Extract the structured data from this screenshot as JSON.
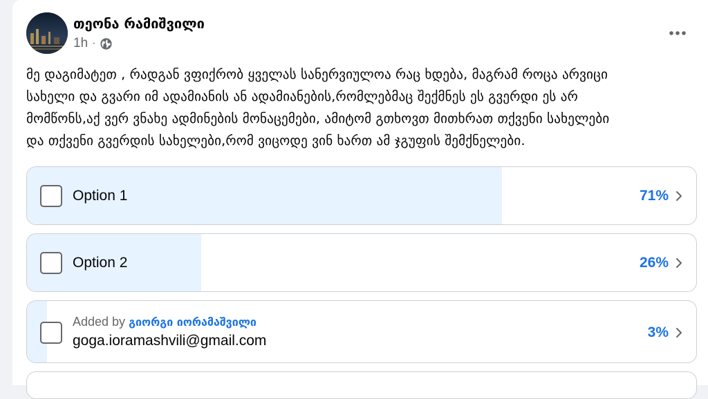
{
  "post": {
    "author": "თეონა რამიშვილი",
    "time": "1h",
    "privacy_icon": "globe-icon",
    "more_icon": "more-horizontal-icon",
    "text_lines": [
      "მე დაგიმატეთ , რადგან ვფიქრობ ყველას სანერვიულოა რაც ხდება, მაგრამ როცა არვიცი",
      "სახელი და გვარი იმ ადამიანის ან ადამიანების,რომლებმაც შექმნეს ეს გვერდი ეს არ",
      "მომწონს,აქ ვერ ვნახე ადმინების მონაცემები, ამიტომ გთხოვთ მითხრათ თქვენი სახელები",
      "და თქვენი გვერდის სახელები,რომ ვიცოდე ვინ ხართ ამ ჯგუფის შემქნელები."
    ]
  },
  "poll": {
    "options": [
      {
        "label": "Option 1",
        "percent_text": "71%",
        "percent": 71
      },
      {
        "label": "Option 2",
        "percent_text": "26%",
        "percent": 26
      },
      {
        "added_by_prefix": "Added by",
        "added_by_name": "გიორგი იორამაშვილი",
        "label": "goga.ioramashvili@gmail.com",
        "percent_text": "3%",
        "percent": 3
      }
    ]
  },
  "colors": {
    "accent": "#1b74e4",
    "fill": "#e7f3ff",
    "border": "#ced0d4",
    "secondary_text": "#65676b"
  }
}
